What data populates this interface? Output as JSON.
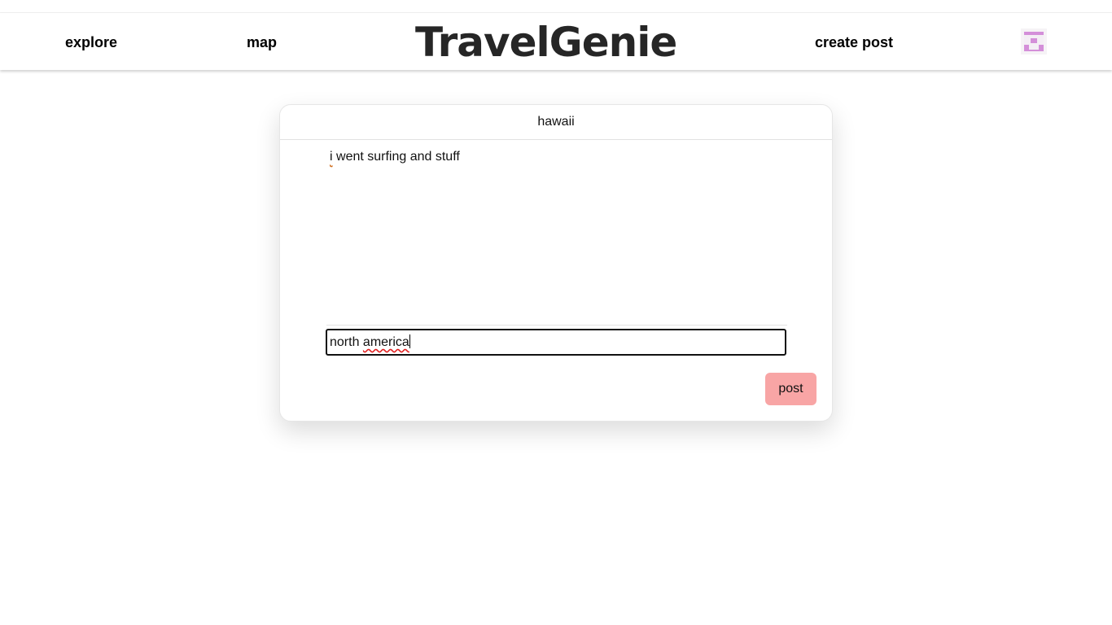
{
  "navbar": {
    "explore_label": "explore",
    "map_label": "map",
    "brand": "TravelGenie",
    "create_post_label": "create post",
    "avatar_icon": "identicon-avatar-icon",
    "avatar_color": "#d48fd9"
  },
  "post_form": {
    "title_value": "hawaii",
    "body_first_word": "i",
    "body_rest": " went surfing and stuff",
    "location_word_1": "north",
    "location_word_2": "america",
    "post_button_label": "post",
    "post_button_color": "#f8a5a5"
  }
}
